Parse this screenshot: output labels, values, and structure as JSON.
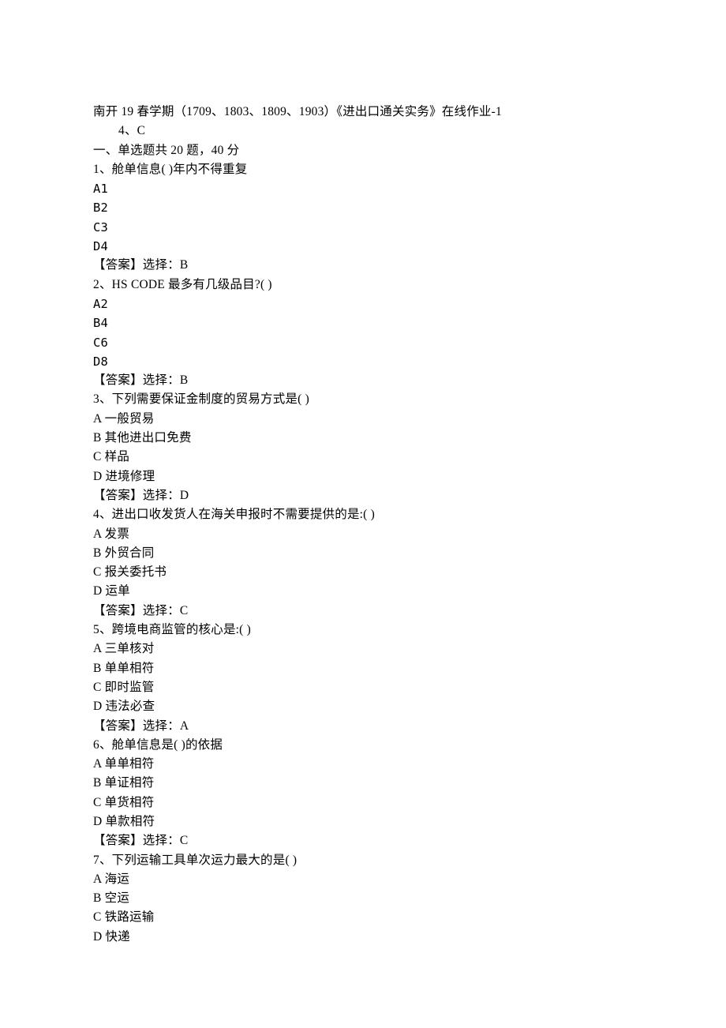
{
  "header": {
    "title_line": "南开 19 春学期（1709、1803、1809、1903）《进出口通关实务》在线作业-1",
    "sub_line": "4、C"
  },
  "section1": {
    "header": "一、单选题共 20 题，40 分"
  },
  "questions": [
    {
      "num": "1、舱单信息( )年内不得重复",
      "opts": [
        "A1",
        "B2",
        "C3",
        "D4"
      ],
      "ans": "【答案】选择：B"
    },
    {
      "num": "2、HS CODE 最多有几级品目?( )",
      "opts": [
        "A2",
        "B4",
        "C6",
        "D8"
      ],
      "ans": "【答案】选择：B"
    },
    {
      "num": "3、下列需要保证金制度的贸易方式是( )",
      "opts": [
        "A 一般贸易",
        "B 其他进出口免费",
        "C 样品",
        "D 进境修理"
      ],
      "ans": "【答案】选择：D"
    },
    {
      "num": "4、进出口收发货人在海关申报时不需要提供的是:( )",
      "opts": [
        "A 发票",
        "B 外贸合同",
        "C 报关委托书",
        "D 运单"
      ],
      "ans": "【答案】选择：C"
    },
    {
      "num": "5、跨境电商监管的核心是:( )",
      "opts": [
        "A 三单核对",
        "B 单单相符",
        "C 即时监管",
        "D 违法必查"
      ],
      "ans": "【答案】选择：A"
    },
    {
      "num": "6、舱单信息是( )的依据",
      "opts": [
        "A 单单相符",
        "B 单证相符",
        "C 单货相符",
        "D 单款相符"
      ],
      "ans": "【答案】选择：C"
    },
    {
      "num": "7、下列运输工具单次运力最大的是( )",
      "opts": [
        "A 海运",
        "B 空运",
        "C 铁路运输",
        "D 快递"
      ],
      "ans": ""
    }
  ]
}
